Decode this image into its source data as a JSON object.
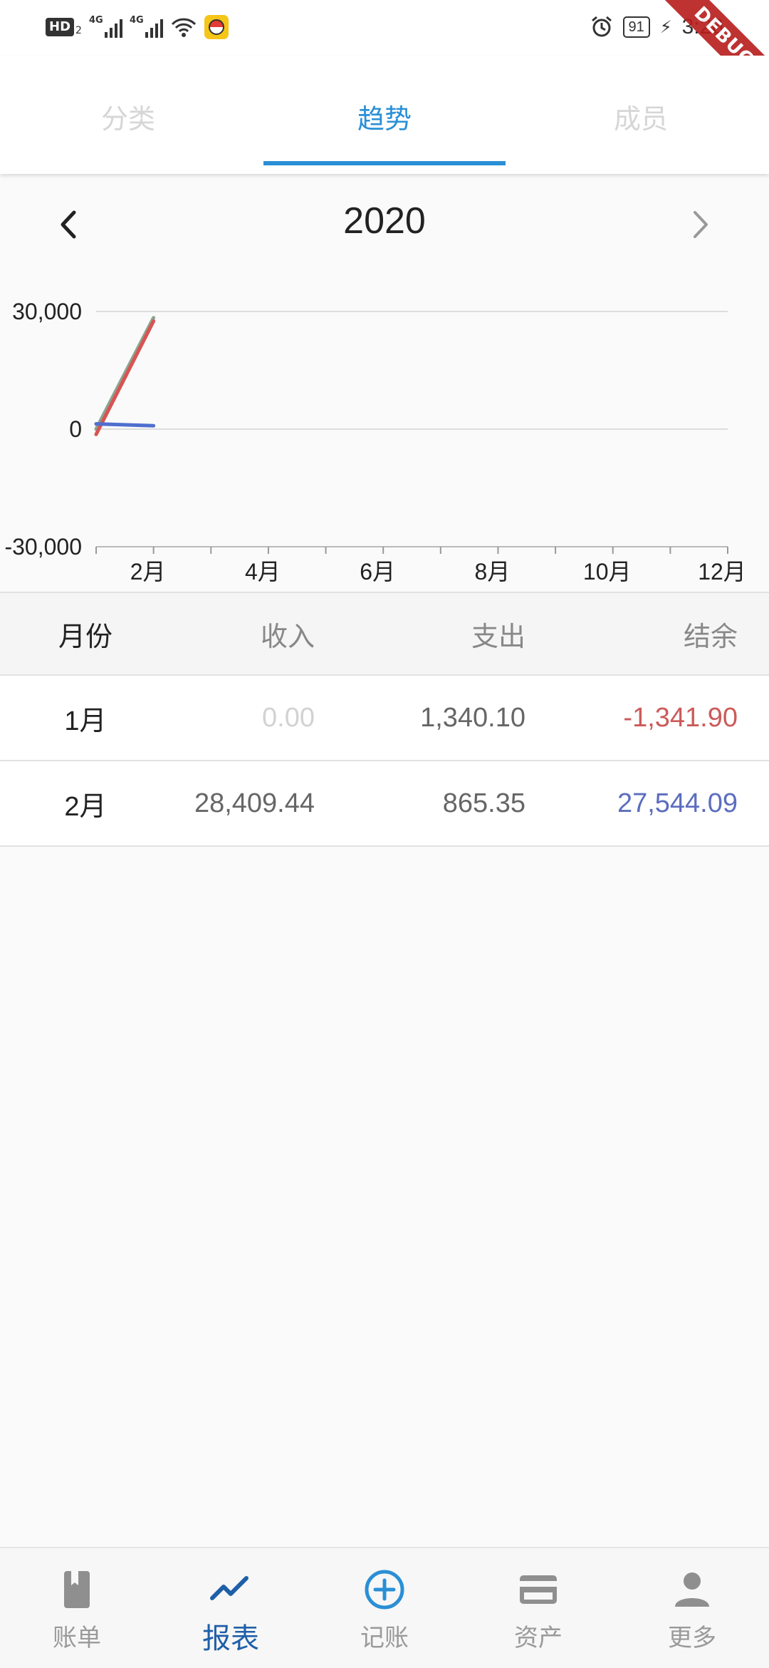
{
  "status_bar": {
    "hd_badge": "HD",
    "hd_sub": "2",
    "network_1": "4G",
    "network_2": "4G",
    "battery": "91",
    "time": "3:26"
  },
  "debug_ribbon": "DEBUG",
  "tabs": [
    {
      "label": "分类",
      "active": false
    },
    {
      "label": "趋势",
      "active": true
    },
    {
      "label": "成员",
      "active": false
    }
  ],
  "year_selector": {
    "year": "2020",
    "prev_icon": "chevron-left-icon",
    "next_icon": "chevron-right-icon"
  },
  "chart_data": {
    "type": "line",
    "ylim": [
      -30000,
      30000
    ],
    "y_ticks": [
      "30,000",
      "0",
      "-30,000"
    ],
    "x_ticks": [
      "2月",
      "4月",
      "6月",
      "8月",
      "10月",
      "12月"
    ],
    "xlim": [
      1,
      12
    ],
    "series": [
      {
        "values": [
          {
            "x": 1,
            "y": 0.0
          },
          {
            "x": 2,
            "y": 28409.44
          }
        ],
        "color": "#8aa58f"
      },
      {
        "values": [
          {
            "x": 1,
            "y": -1341.9
          },
          {
            "x": 2,
            "y": 27544.09
          }
        ],
        "color": "#d95353"
      },
      {
        "values": [
          {
            "x": 1,
            "y": 1340.1
          },
          {
            "x": 2,
            "y": 865.35
          }
        ],
        "color": "#4f6fcf"
      }
    ]
  },
  "table": {
    "headers": {
      "month": "月份",
      "income": "收入",
      "expense": "支出",
      "balance": "结余"
    },
    "rows": [
      {
        "month": "1月",
        "income": "0.00",
        "expense": "1,340.10",
        "balance": "-1,341.90"
      },
      {
        "month": "2月",
        "income": "28,409.44",
        "expense": "865.35",
        "balance": "27,544.09"
      }
    ]
  },
  "bottom_nav": [
    {
      "label": "账单",
      "icon": "book-icon",
      "active": false
    },
    {
      "label": "报表",
      "icon": "trend-icon",
      "active": true
    },
    {
      "label": "记账",
      "icon": "add-circle-icon",
      "active": false
    },
    {
      "label": "资产",
      "icon": "card-icon",
      "active": false
    },
    {
      "label": "更多",
      "icon": "person-icon",
      "active": false
    }
  ],
  "colors": {
    "accent": "#2a8fd6",
    "nav_active": "#1f5fa8",
    "negative": "#cc5a5a",
    "positive": "#5b6dbf"
  }
}
